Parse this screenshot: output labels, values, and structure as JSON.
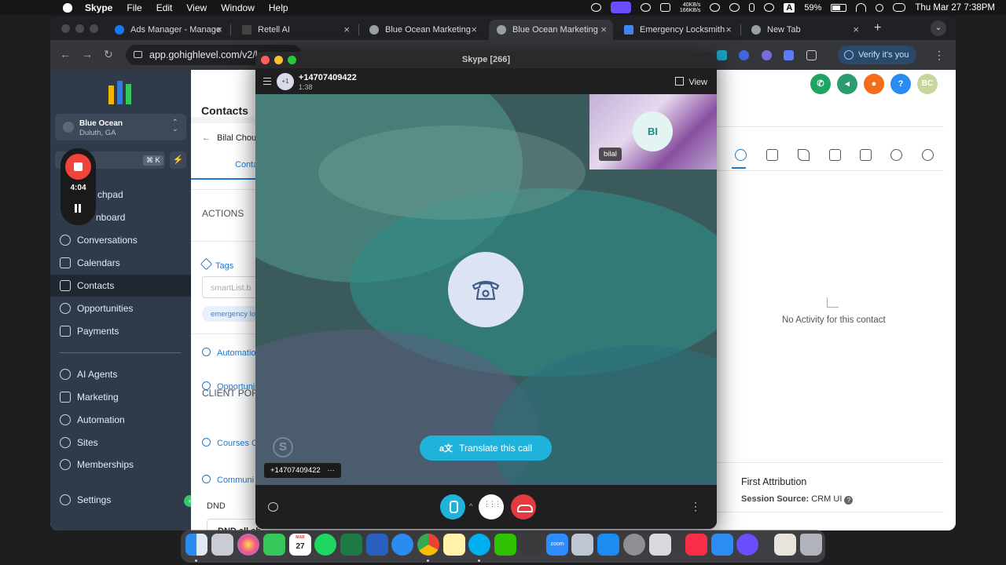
{
  "menubar": {
    "app_name": "Skype",
    "items": [
      "File",
      "Edit",
      "View",
      "Window",
      "Help"
    ],
    "net_up": "40KB/s",
    "net_down": "166KB/s",
    "keyboard": "A",
    "battery": "59%",
    "datetime": "Thu Mar 27  7:38PM"
  },
  "browser": {
    "tabs": [
      {
        "label": "Ads Manager - Manage",
        "color": "#1877f2"
      },
      {
        "label": "Retell AI",
        "color": "#333333"
      },
      {
        "label": "Blue Ocean Marketing",
        "color": "#9aa0a6"
      },
      {
        "label": "Blue Ocean Marketing",
        "color": "#9aa0a6"
      },
      {
        "label": "Emergency Locksmith",
        "color": "#4285f4"
      },
      {
        "label": "New Tab",
        "color": "#9aa0a6"
      }
    ],
    "url": "app.gohighlevel.com/v2/lo",
    "verify_label": "Verify it's you"
  },
  "sidebar": {
    "location_name": "Blue Ocean",
    "location_sub": "Duluth, GA",
    "search_shortcut": "⌘ K",
    "nav_items": [
      {
        "label": "Launchpad"
      },
      {
        "label": "Dashboard"
      },
      {
        "label": "Conversations"
      },
      {
        "label": "Calendars"
      },
      {
        "label": "Contacts"
      },
      {
        "label": "Opportunities"
      },
      {
        "label": "Payments"
      },
      {
        "label": "AI Agents"
      },
      {
        "label": "Marketing"
      },
      {
        "label": "Automation"
      },
      {
        "label": "Sites"
      },
      {
        "label": "Memberships"
      },
      {
        "label": "Settings"
      }
    ],
    "active_item": "Contacts",
    "nav_partial": [
      "chpad",
      "nboard"
    ]
  },
  "recorder": {
    "time": "4:04"
  },
  "contacts": {
    "title": "Contacts",
    "contact_name": "Bilal Chou",
    "tab_label": "Conta",
    "actions_label": "ACTIONS",
    "tags_label": "Tags",
    "tag_input_placeholder": "smartList.b",
    "tag_chip": "emergency lo",
    "automation_label": "Automatio",
    "opportunity_label": "Opportuni",
    "client_portal_label": "CLIENT POR",
    "courses_label": "Courses O",
    "communication_label": "Communi",
    "dnd_label": "DND",
    "dnd_all_label": "DND all ch"
  },
  "right_panel": {
    "avatar_initials": "BC",
    "help_label": "?",
    "no_activity": "No Activity for this contact",
    "first_attribution": "First Attribution",
    "session_source_label": "Session Source:",
    "session_source_value": "CRM UI"
  },
  "skype": {
    "window_title": "Skype [266]",
    "avatar_label": "+1",
    "caller_number": "+14707409422",
    "call_duration": "1:38",
    "view_label": "View",
    "self_initials": "BI",
    "self_name": "bilal",
    "translate_label": "Translate this call",
    "caller_chip": "+14707409422",
    "caller_chip_more": "···"
  },
  "dock": {
    "calendar_month": "MAR",
    "calendar_day": "27",
    "zoom_label": "zoom"
  }
}
